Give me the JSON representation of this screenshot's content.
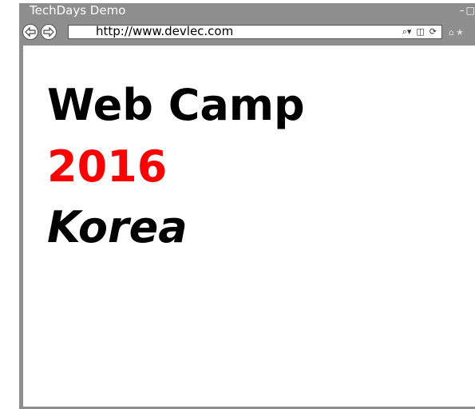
{
  "window": {
    "title": "TechDays Demo",
    "controls": [
      "–",
      "□"
    ]
  },
  "toolbar": {
    "url": "http://www.devlec.com",
    "address_icons": [
      "search-dropdown-icon",
      "compat-view-icon",
      "refresh-icon"
    ],
    "browser_icons": [
      "home-icon",
      "favorites-icon"
    ]
  },
  "content": {
    "line1": "Web Camp",
    "line2": "2016",
    "line3": "Korea"
  },
  "colors": {
    "accent": "#ff0000",
    "frame": "#8e8e8e"
  }
}
